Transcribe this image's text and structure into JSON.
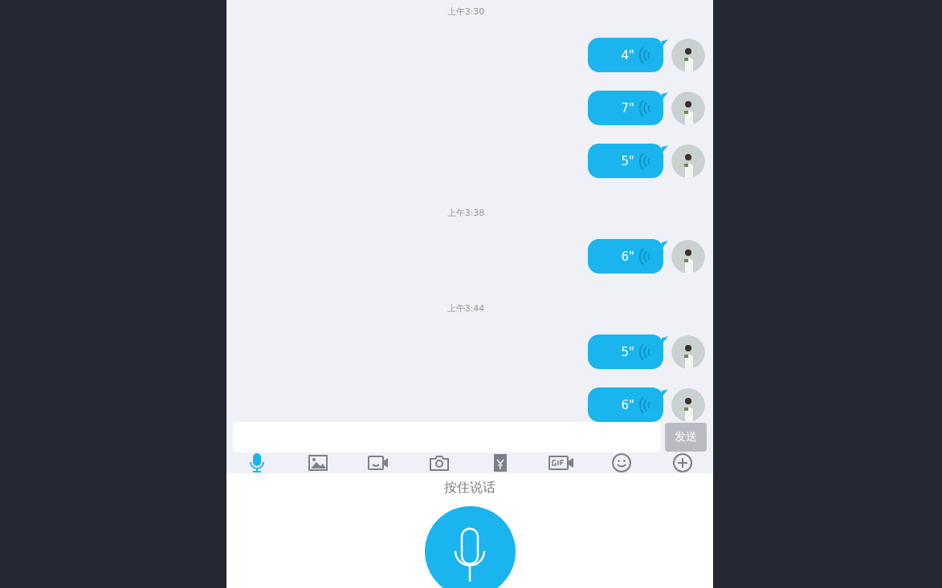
{
  "messages": [
    {
      "kind": "time",
      "text": "上午3:30"
    },
    {
      "kind": "voice",
      "duration": "4\""
    },
    {
      "kind": "voice",
      "duration": "7\""
    },
    {
      "kind": "voice",
      "duration": "5\""
    },
    {
      "kind": "time",
      "text": "上午3:38"
    },
    {
      "kind": "voice",
      "duration": "6\""
    },
    {
      "kind": "time",
      "text": "上午3:44"
    },
    {
      "kind": "voice",
      "duration": "5\""
    },
    {
      "kind": "voice",
      "duration": "6\""
    }
  ],
  "send_button": {
    "label": "发送",
    "disabled": true
  },
  "toolbar": [
    {
      "kind": "mic",
      "selected": true
    },
    {
      "kind": "image",
      "selected": false
    },
    {
      "kind": "video",
      "selected": false
    },
    {
      "kind": "camera",
      "selected": false
    },
    {
      "kind": "redpacket",
      "selected": false
    },
    {
      "kind": "gif",
      "selected": false
    },
    {
      "kind": "emoji",
      "selected": false
    },
    {
      "kind": "plus",
      "selected": false
    }
  ],
  "voice_panel": {
    "hint": "按住说话"
  }
}
